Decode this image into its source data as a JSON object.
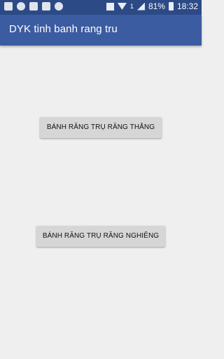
{
  "status_bar": {
    "battery_percent": "81%",
    "time": "18:32",
    "sim_indicator": "1",
    "left_icons": [
      "sms-icon",
      "viber-icon",
      "email-icon",
      "gallery-icon",
      "messenger-icon"
    ],
    "right_icons": [
      "mute-icon",
      "wifi-icon",
      "sim-icon",
      "signal-icon",
      "battery-icon"
    ]
  },
  "app_bar": {
    "title": "DYK tinh banh rang tru"
  },
  "main": {
    "button_straight_label": "BÁNH RĂNG TRỤ RĂNG THẲNG",
    "button_helical_label": "BÁNH RĂNG TRỤ RĂNG NGHIÊNG"
  },
  "colors": {
    "status_bar": "#2c4a86",
    "app_bar": "#3b5ca0",
    "background": "#efefef",
    "button": "#d6d6d6"
  }
}
